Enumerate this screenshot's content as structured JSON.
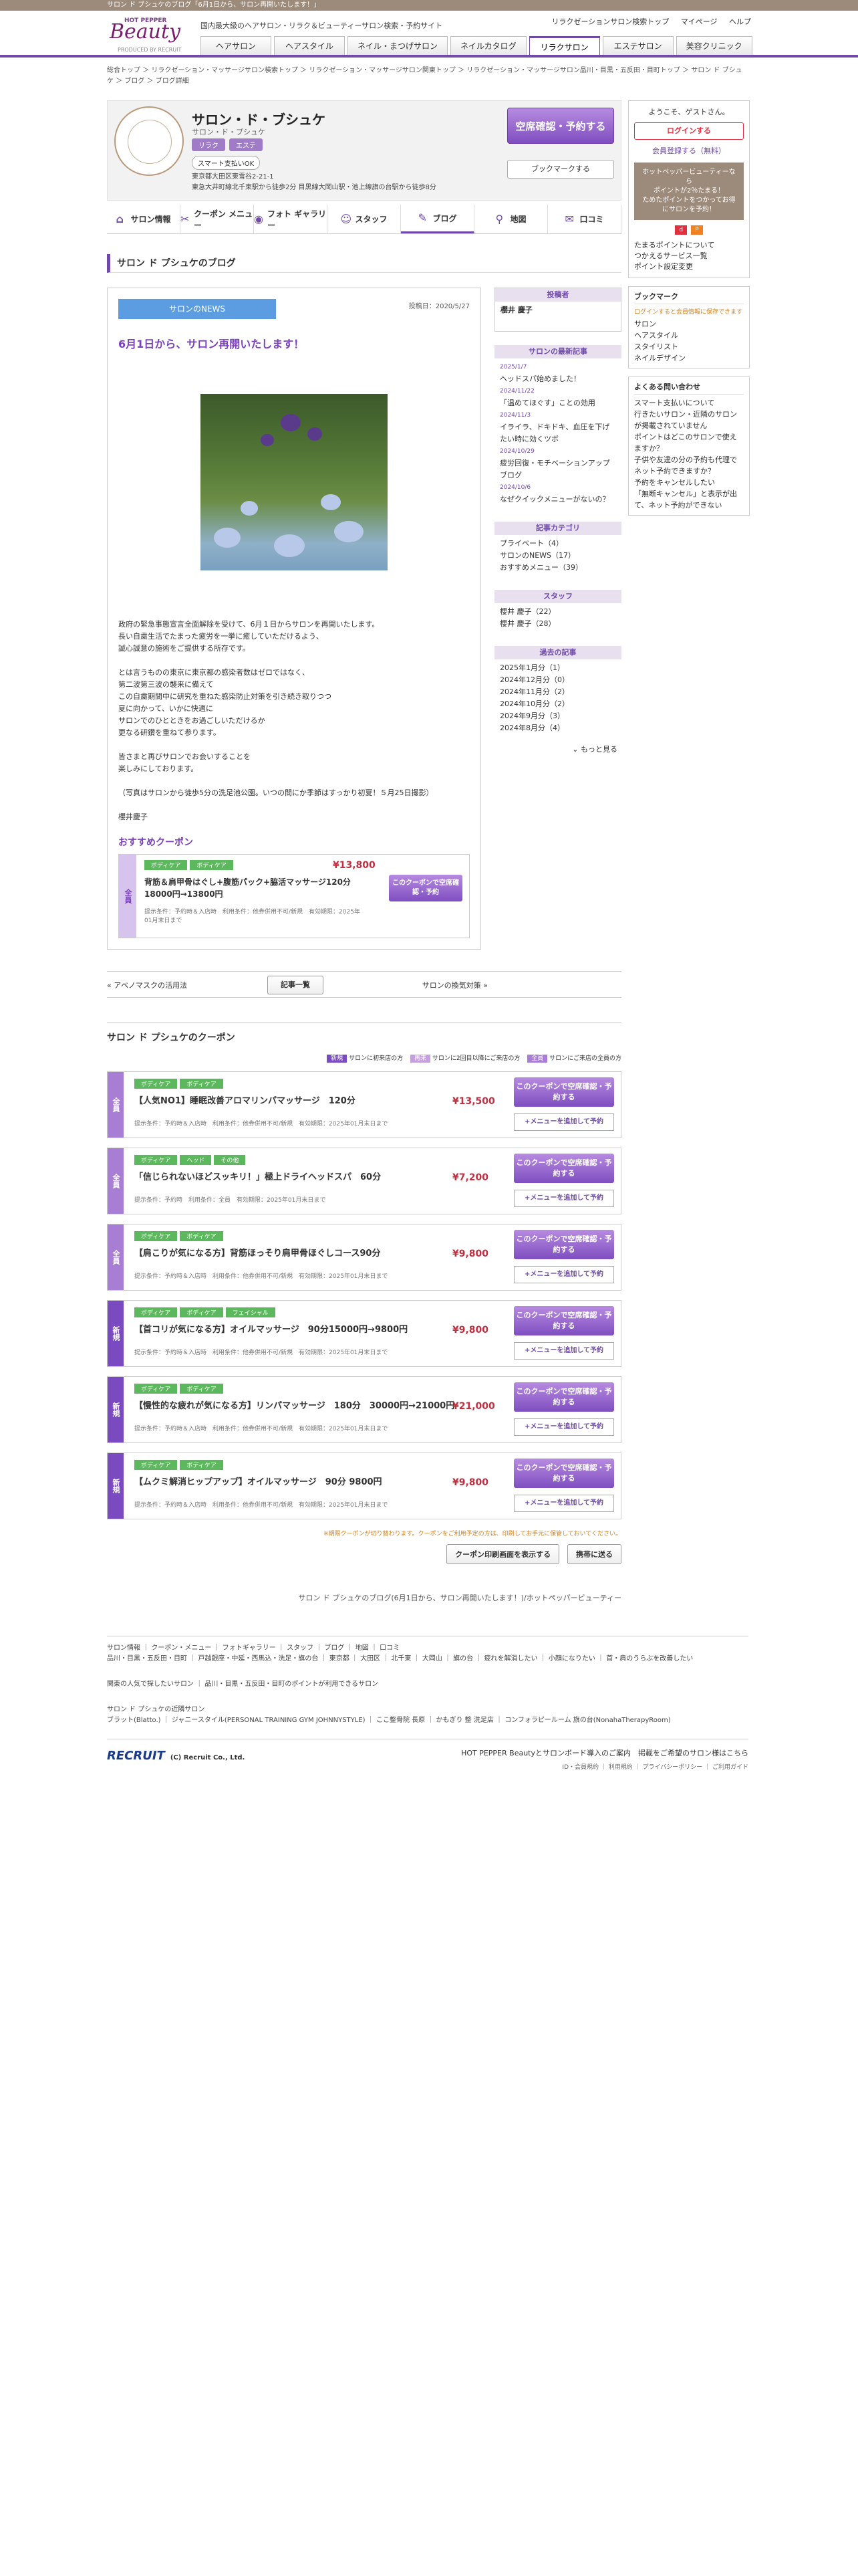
{
  "topbar": "サロン ド ブシュケのブログ「6月1日から、サロン再開いたします！」",
  "header": {
    "logo_brand": "HOT PEPPER",
    "logo_name": "Beauty",
    "logo_by": "PRODUCED BY RECRUIT",
    "tagline": "国内最大級のヘアサロン・リラク＆ビューティーサロン検索・予約サイト",
    "links": [
      "リラクゼーションサロン検索トップ",
      "マイページ",
      "ヘルプ"
    ],
    "tabs": [
      "ヘアサロン",
      "ヘアスタイル",
      "ネイル・まつげサロン",
      "ネイルカタログ",
      "リラクサロン",
      "エステサロン",
      "美容クリニック"
    ]
  },
  "breadcrumb": "総合トップ ＞ リラクゼーション・マッサージサロン検索トップ ＞ リラクゼーション・マッサージサロン関東トップ ＞ リラクゼーション・マッサージサロン品川・目黒・五反田・目町トップ ＞ サロン ド ブシュケ ＞ ブログ ＞ ブログ詳細",
  "salon": {
    "name": "サロン・ド・ブシュケ",
    "kana": "サロン・ド・プシュケ",
    "badges": [
      "リラク",
      "エステ"
    ],
    "smartpay": "スマート支払いOK",
    "address1": "東京都大田区東雪谷2-21-1",
    "address2": "東急大井町線北千束駅から徒歩2分 目黒線大岡山駅・池上線旗の台駅から徒歩8分",
    "book": "空席確認・予約する",
    "bookmark": "ブックマークする",
    "nav": [
      "サロン情報",
      "クーポン メニュー",
      "フォト ギャラリー",
      "スタッフ",
      "ブログ",
      "地図",
      "口コミ"
    ]
  },
  "blog": {
    "section_title": "サロン ド プシュケのブログ",
    "category": "サロンのNEWS",
    "date": "投稿日：2020/5/27",
    "title": "6月1日から、サロン再開いたします！",
    "body": "政府の緊急事態宣言全面解除を受けて、6月１日からサロンを再開いたします。\n長い自粛生活でたまった疲労を一挙に癒していただけるよう、\n誠心誠意の施術をご提供する所存です。\n\nとは言うものの東京に東京都の感染者数はゼロではなく、\n第二波第三波の襲来に備えて\nこの自粛期間中に研究を重ねた感染防止対策を引き続き取りつつ\n夏に向かって、いかに快適に\nサロンでのひとときをお過ごしいただけるか\n更なる研鑽を重ねて参ります。\n\n皆さまと再びサロンでお会いすることを\n楽しみにしております。\n\n（写真はサロンから徒歩5分の洗足池公園。いつの間にか季節はすっかり初夏！５月25日撮影）\n\n櫻井慶子",
    "osusume_title": "おすすめクーポン",
    "mini_coupon": {
      "side": "全員",
      "tags": [
        "ボディケア",
        "ボディケア"
      ],
      "price": "¥13,800",
      "name": "背筋＆肩甲骨はぐし+腹筋パック+脇活マッサージ120分　18000円→13800円",
      "meta": "提示条件：予約時＆入店時　利用条件：他券併用不可/新規　有効期限：2025年01月末日まで",
      "btn": "このクーポンで空席確認・予約"
    }
  },
  "right": {
    "poster_title": "投稿者",
    "poster": "櫻井 慶子",
    "recent_title": "サロンの最新記事",
    "recent": [
      {
        "date": "2025/1/7",
        "title": "ヘッドスパ始めました！"
      },
      {
        "date": "2024/11/22",
        "title": "「温めてほぐす」ことの効用"
      },
      {
        "date": "2024/11/3",
        "title": "イライラ、ドキドキ、血圧を下げたい時に効くツボ"
      },
      {
        "date": "2024/10/29",
        "title": "疲労回復・モチベーションアップブログ"
      },
      {
        "date": "2024/10/6",
        "title": "なぜクイックメニューがないの？"
      }
    ],
    "category_title": "記事カテゴリ",
    "categories": [
      "プライベート（4）",
      "サロンのNEWS（17）",
      "おすすめメニュー（39）"
    ],
    "staff_title": "スタッフ",
    "staff": [
      "櫻井 慶子（22）",
      "櫻井 慶子（28）"
    ],
    "archive_title": "過去の記事",
    "archive": [
      "2025年1月分（1）",
      "2024年12月分（0）",
      "2024年11月分（2）",
      "2024年10月分（2）",
      "2024年9月分（3）",
      "2024年8月分（4）"
    ],
    "more": "もっと見る"
  },
  "pager": {
    "prev": "« アベノマスクの活用法",
    "list": "記事一覧",
    "next": "サロンの換気対策 »"
  },
  "coupons": {
    "title": "サロン ド プシュケのクーポン",
    "legend": [
      {
        "k": "新規",
        "t": "サロンに初来店の方"
      },
      {
        "k": "再来",
        "t": "サロンに2回目以降にご来店の方"
      },
      {
        "k": "全員",
        "t": "サロンにご来店の全員の方"
      }
    ],
    "items": [
      {
        "side": "全員",
        "color": "#a87ed4",
        "tags": [
          "ボディケア",
          "ボディケア"
        ],
        "name": "【人気NO1】睡眠改善アロマリンパマッサージ　120分",
        "price": "¥13,500",
        "meta": "提示条件：予約時＆入店時　利用条件：他券併用不可/新規　有効期限：2025年01月末日まで"
      },
      {
        "side": "全員",
        "color": "#a87ed4",
        "tags": [
          "ボディケア",
          "ヘッド",
          "その他"
        ],
        "name": "「信じられないほどスッキリ！」極上ドライヘッドスパ　60分",
        "price": "¥7,200",
        "meta": "提示条件：予約時　利用条件：全員　有効期限：2025年01月末日まで"
      },
      {
        "side": "全員",
        "color": "#a87ed4",
        "tags": [
          "ボディケア",
          "ボディケア"
        ],
        "name": "【肩こりが気になる方】背筋ほっそり肩甲骨ほぐしコース90分",
        "price": "¥9,800",
        "meta": "提示条件：予約時＆入店時　利用条件：他券併用不可/新規　有効期限：2025年01月末日まで"
      },
      {
        "side": "新規",
        "color": "#7a4ac0",
        "tags": [
          "ボディケア",
          "ボディケア",
          "フェイシャル"
        ],
        "name": "【首コリが気になる方】オイルマッサージ　90分15000円→9800円",
        "price": "¥9,800",
        "meta": "提示条件：予約時＆入店時　利用条件：他券併用不可/新規　有効期限：2025年01月末日まで"
      },
      {
        "side": "新規",
        "color": "#7a4ac0",
        "tags": [
          "ボディケア",
          "ボディケア"
        ],
        "name": "【慢性的な疲れが気になる方】リンパマッサージ　180分　30000円→21000円",
        "price": "¥21,000",
        "meta": "提示条件：予約時＆入店時　利用条件：他券併用不可/新規　有効期限：2025年01月末日まで"
      },
      {
        "side": "新規",
        "color": "#7a4ac0",
        "tags": [
          "ボディケア",
          "ボディケア"
        ],
        "name": "【ムクミ解消ヒップアップ】オイルマッサージ　90分 9800円",
        "price": "¥9,800",
        "meta": "提示条件：予約時＆入店時　利用条件：他券併用不可/新規　有効期限：2025年01月末日まで"
      }
    ],
    "btn1": "このクーポンで空席確認・予約する",
    "btn2": "+メニューを追加して予約",
    "note": "※期限クーポンが切り替わります。クーポンをご利用予定の方は、印刷してお手元に保管しておいてください。",
    "print": "クーポン印刷画面を表示する",
    "mobile": "携帯に送る"
  },
  "foot_title": "サロン ド ブシュケのブログ(6月1日から、サロン再開いたします！)/ホットペッパービューティー",
  "sidebar": {
    "welcome": "ようこそ、ゲストさん。",
    "login": "ログインする",
    "register": "会員登録する（無料）",
    "promo": "ホットペッパービューティーなら\nポイントが2％たまる！\nためたポイントをつかってお得にサロンを予約！",
    "points": [
      "たまるポイントについて",
      "つかえるサービス一覧",
      "ポイント設定変更"
    ],
    "bm_title": "ブックマーク",
    "bm_note": "ログインすると会員情報に保存できます",
    "bm_items": [
      "サロン",
      "ヘアスタイル",
      "スタイリスト",
      "ネイルデザイン"
    ],
    "faq_title": "よくある問い合わせ",
    "faq": [
      "スマート支払いについて",
      "行きたいサロン・近隣のサロンが掲載されていません",
      "ポイントはどこのサロンで使えますか？",
      "子供や友達の分の予約も代理でネット予約できますか？",
      "予約をキャンセルしたい",
      "「無断キャンセル」と表示が出て、ネット予約ができない"
    ]
  },
  "footer": {
    "links": "サロン情報 ｜ クーポン・メニュー ｜ フォトギャラリー ｜ スタッフ ｜ ブログ ｜ 地図 ｜ 口コミ",
    "areas": "品川・目黒・五反田・目町 ｜ 戸越銀座・中延・西馬込・洗足・旗の台 ｜ 東京都 ｜ 大田区 ｜ 北千東 ｜ 大岡山 ｜ 旗の台 ｜ 疲れを解消したい ｜ 小顔になりたい ｜ 首・肩のうらぶを改善したい",
    "pref": "関東の人気で探したいサロン ｜ 品川・目黒・五反田・目町のポイントが利用できるサロン",
    "nearby_title": "サロン ド プシュケの近隣サロン",
    "nearby": "ブラット(Blatto.) ｜ ジャニースタイル(PERSONAL TRAINING GYM JOHNNYSTYLE) ｜ ここ整骨院 長原 ｜ かもぎり 整 洗足店 ｜ コンフォラピールーム 旗の台(NonahaTherapyRoom)",
    "copyright": "(C) Recruit Co., Ltd.",
    "right1": "HOT PEPPER Beautyとサロンボード導入のご案内　掲載をご希望のサロン様はこちら",
    "right2": "ID・会員規約 ｜ 利用規約 ｜ プライバシーポリシー ｜ ご利用ガイド"
  }
}
